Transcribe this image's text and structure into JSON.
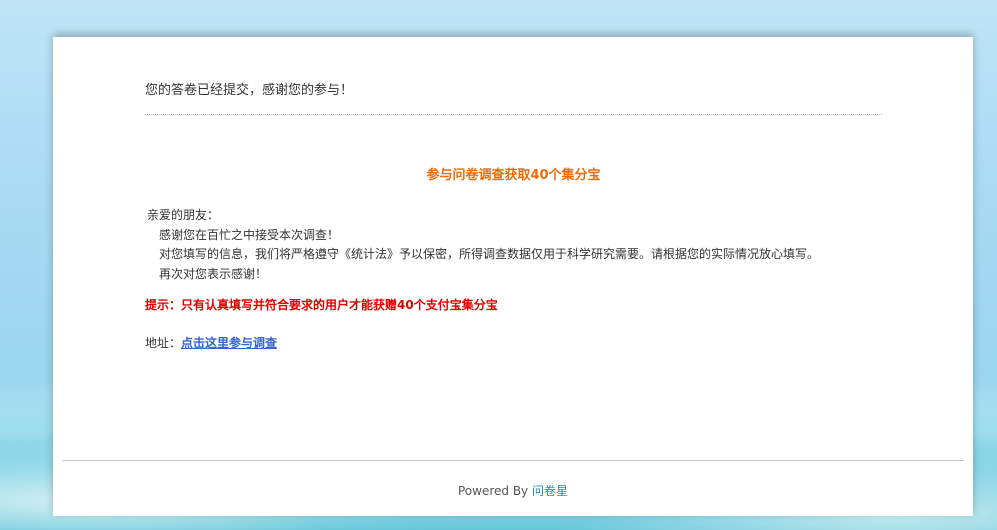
{
  "page": {
    "submitted_message": "您的答卷已经提交，感谢您的参与！",
    "headline": "参与问卷调查获取40个集分宝",
    "body": {
      "greeting": "亲爱的朋友：",
      "line1": "感谢您在百忙之中接受本次调查！",
      "line2": "对您填写的信息，我们将严格遵守《统计法》予以保密，所得调查数据仅用于科学研究需要。请根据您的实际情况放心填写。",
      "line3": "再次对您表示感谢！"
    },
    "hint": "提示：只有认真填写并符合要求的用户才能获赠40个支付宝集分宝",
    "address": {
      "label": "地址：",
      "link_text": "点击这里参与调查"
    },
    "footer": {
      "powered_by": "Powered By",
      "brand": "问卷星"
    }
  },
  "colors": {
    "headline": "#ef6b09",
    "hint": "#e50000",
    "link": "#3366cc",
    "brand_link": "#1a8fc9"
  }
}
